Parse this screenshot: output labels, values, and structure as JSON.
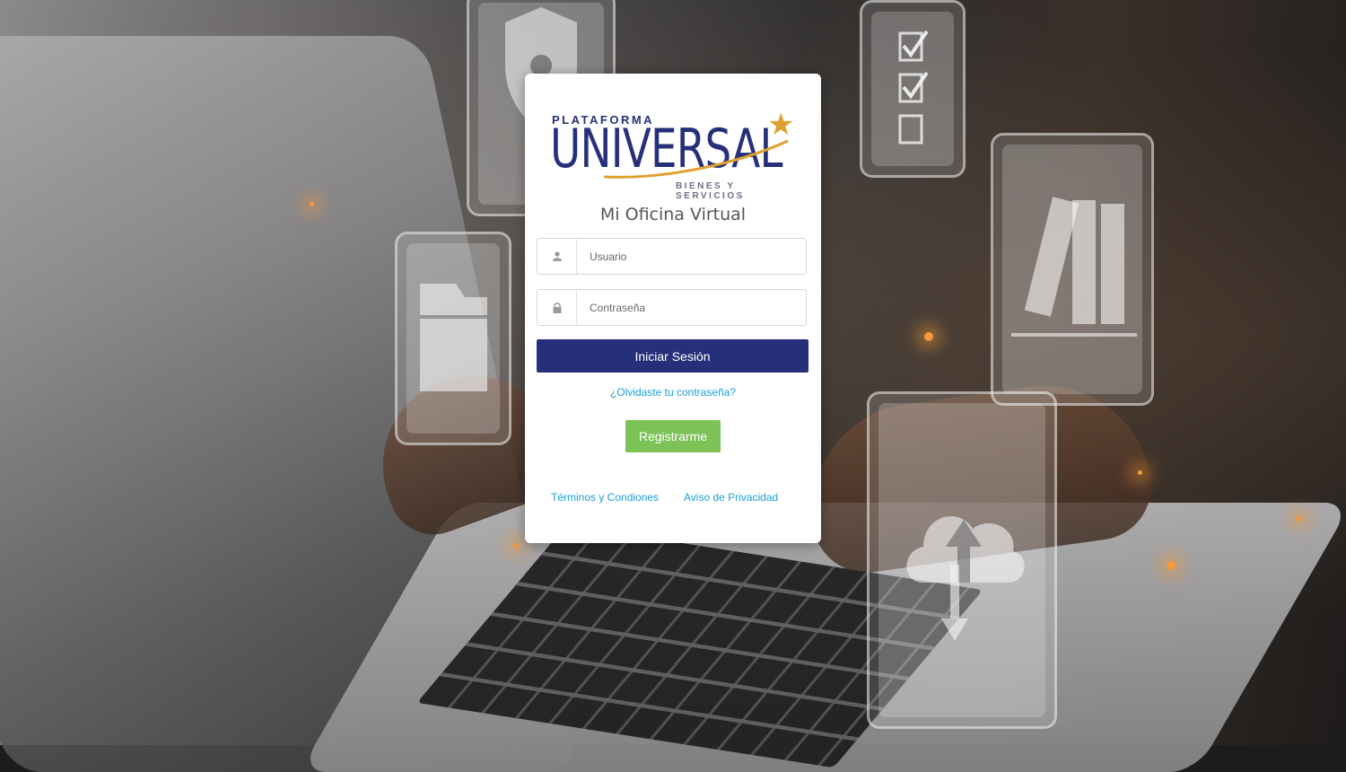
{
  "logo": {
    "top_text": "PLATAFORMA",
    "main_text": "UNIVERSAL",
    "sub_text": "BIENES Y SERVICIOS",
    "brand_color": "#26307a",
    "star_color": "#e0a030"
  },
  "login": {
    "title": "Mi Oficina Virtual",
    "username_placeholder": "Usuario",
    "password_placeholder": "Contraseña",
    "submit_label": "Iniciar Sesión",
    "forgot_label": "¿Olvidaste tu contraseña?",
    "register_label": "Registrarme"
  },
  "footer": {
    "terms_label": "Términos y Condiones",
    "privacy_label": "Aviso de Privacidad"
  },
  "icons": {
    "user": "user-icon",
    "lock": "lock-icon"
  },
  "colors": {
    "primary_button": "#26307a",
    "register_button": "#7cc257",
    "link": "#1aa0d8"
  }
}
